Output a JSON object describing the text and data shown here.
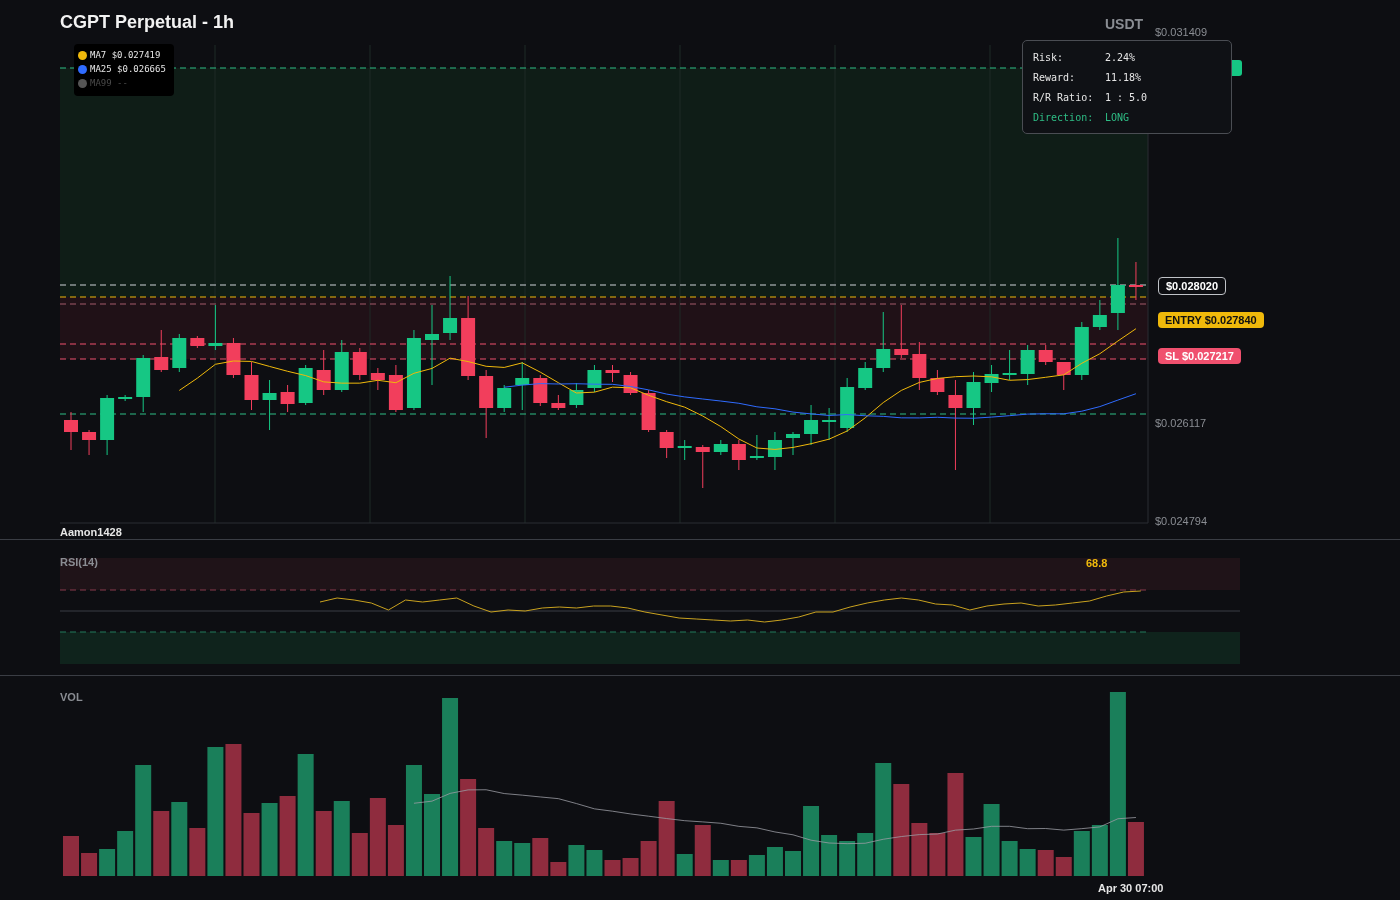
{
  "header": {
    "title": "CGPT Perpetual - 1h",
    "quote_currency": "USDT"
  },
  "legend": [
    {
      "name": "MA7",
      "value": "$0.027419",
      "color": "#f0b90b",
      "disabled": false
    },
    {
      "name": "MA25",
      "value": "$0.026665",
      "color": "#2f6bff",
      "disabled": false
    },
    {
      "name": "MA99",
      "value": "--",
      "color": "#555555",
      "disabled": true
    }
  ],
  "trade_info": {
    "rows": [
      {
        "label": "Risk:",
        "value": "2.24%"
      },
      {
        "label": "Reward:",
        "value": "11.18%"
      },
      {
        "label": "R/R Ratio:",
        "value": "1 : 5.0"
      }
    ],
    "direction": {
      "label": "Direction:",
      "value": "LONG"
    }
  },
  "price_axis": {
    "top": "$0.031409",
    "middle": "$0.026117",
    "bottom": "$0.024794"
  },
  "price_tags": [
    {
      "kind": "last",
      "text": "$0.028020"
    },
    {
      "kind": "entry",
      "text": "ENTRY $0.027840"
    },
    {
      "kind": "stop",
      "text": "SL $0.027217"
    }
  ],
  "footer_label": "Aamon1428",
  "rsi": {
    "label": "RSI(14)",
    "value": "68.8"
  },
  "volume": {
    "label": "VOL",
    "time_label": "Apr 30 07:00"
  }
}
